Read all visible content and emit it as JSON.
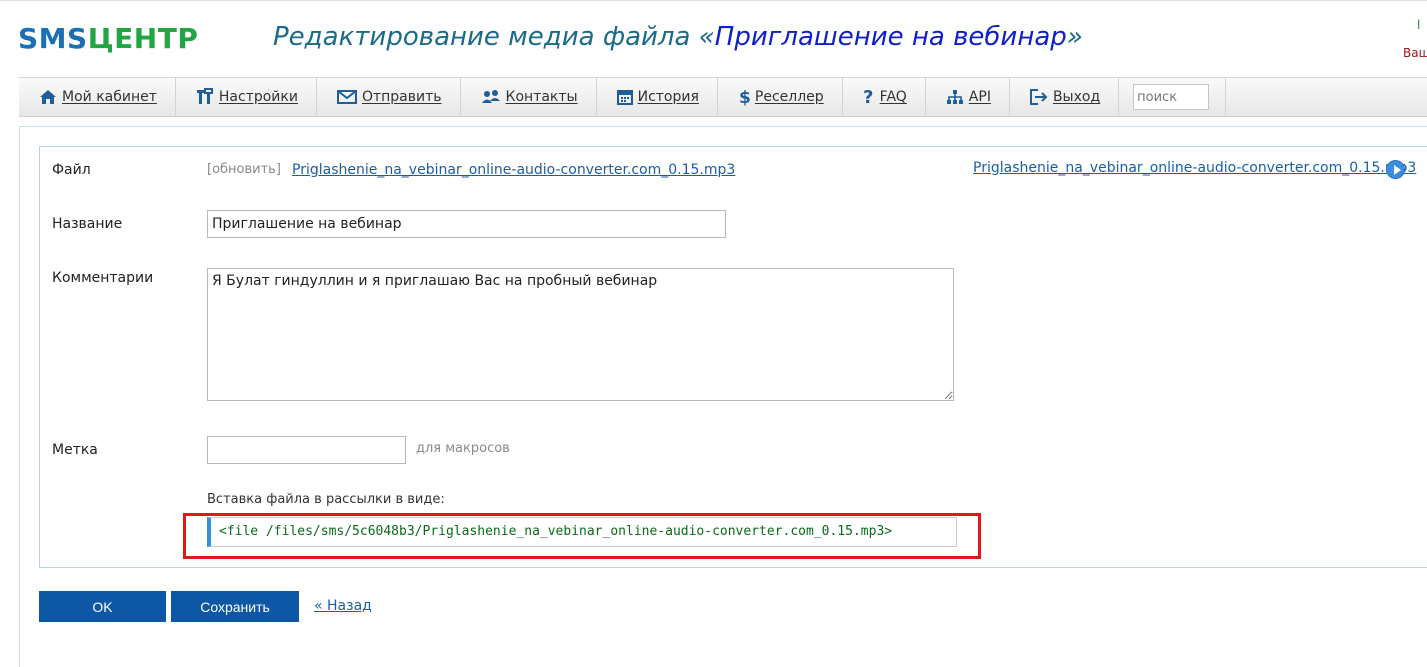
{
  "logo": {
    "part1": "SMS",
    "part2": "ЦЕНТР"
  },
  "page_title": {
    "prefix": "Редактирование медиа файла «",
    "file_name": "Приглашение на вебинар",
    "suffix": "»"
  },
  "user_corner": {
    "line1": "l",
    "line2": "Ваш"
  },
  "nav": {
    "items": [
      {
        "label": "Мой кабинет",
        "icon": "home-icon"
      },
      {
        "label": "Настройки",
        "icon": "tools-icon"
      },
      {
        "label": "Отправить",
        "icon": "envelope-icon"
      },
      {
        "label": "Контакты",
        "icon": "users-icon"
      },
      {
        "label": "История",
        "icon": "calendar-icon"
      },
      {
        "label": "Реселлер",
        "icon": "dollar-icon"
      },
      {
        "label": "FAQ",
        "icon": "question-icon"
      },
      {
        "label": "API",
        "icon": "sitemap-icon"
      },
      {
        "label": "Выход",
        "icon": "logout-icon"
      }
    ],
    "search_placeholder": "поиск"
  },
  "form": {
    "file_label": "Файл",
    "update_button": "[обновить]",
    "file_name": "Priglashenie_na_vebinar_online-audio-converter.com_0.15.mp3",
    "file_name_right": "Priglashenie_na_vebinar_online-audio-converter.com_0.15.mp3",
    "name_label": "Название",
    "name_value": "Приглашение на вебинар",
    "comments_label": "Комментарии",
    "comments_value": "Я Булат гиндуллин и я приглашаю Вас на пробный вебинар",
    "tag_label": "Метка",
    "tag_value": "",
    "tag_hint": "для макросов",
    "insert_label": "Вставка файла в рассылки в виде:",
    "insert_code": "<file /files/sms/5c6048b3/Priglashenie_na_vebinar_online-audio-converter.com_0.15.mp3>"
  },
  "buttons": {
    "ok": "OK",
    "save": "Сохранить",
    "back": "« Назад"
  },
  "colors": {
    "accent_blue": "#0d57a5",
    "highlight_red": "#e01818",
    "logo_green": "#23a544",
    "logo_blue": "#1a6fb5"
  }
}
